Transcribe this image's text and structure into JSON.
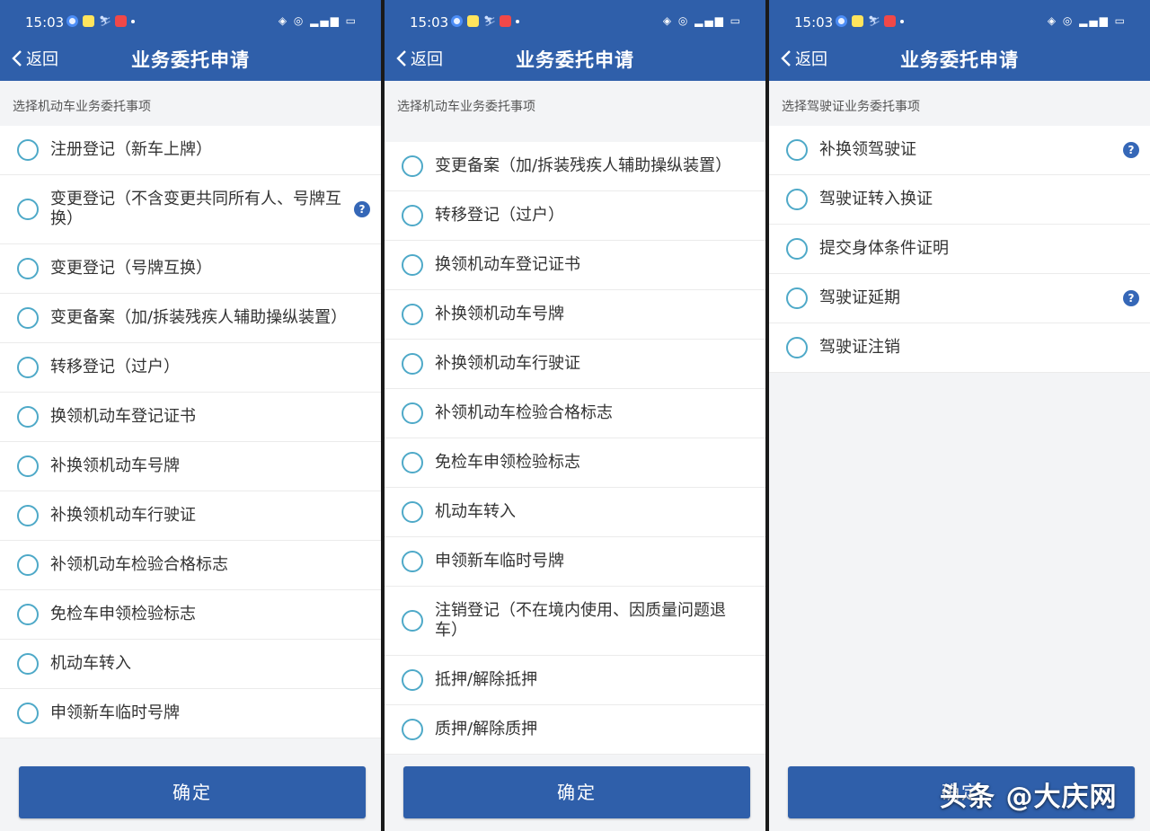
{
  "panels": [
    {
      "status_time": "15:03",
      "back_label": "返回",
      "title": "业务委托申请",
      "section_label": "选择机动车业务委托事项",
      "items": [
        {
          "label": "注册登记（新车上牌）",
          "help": false,
          "lines": 1
        },
        {
          "label": "变更登记（不含变更共同所有人、号牌互换）",
          "help": true,
          "lines": 2
        },
        {
          "label": "变更登记（号牌互换）",
          "help": false,
          "lines": 1
        },
        {
          "label": "变更备案（加/拆装残疾人辅助操纵装置）",
          "help": false,
          "lines": 1
        },
        {
          "label": "转移登记（过户）",
          "help": false,
          "lines": 1
        },
        {
          "label": "换领机动车登记证书",
          "help": false,
          "lines": 1
        },
        {
          "label": "补换领机动车号牌",
          "help": false,
          "lines": 1
        },
        {
          "label": "补换领机动车行驶证",
          "help": false,
          "lines": 1
        },
        {
          "label": "补领机动车检验合格标志",
          "help": false,
          "lines": 1
        },
        {
          "label": "免检车申领检验标志",
          "help": false,
          "lines": 1
        },
        {
          "label": "机动车转入",
          "help": false,
          "lines": 1
        },
        {
          "label": "申领新车临时号牌",
          "help": false,
          "lines": 1
        }
      ],
      "confirm_label": "确定"
    },
    {
      "status_time": "15:03",
      "back_label": "返回",
      "title": "业务委托申请",
      "section_label": "选择机动车业务委托事项",
      "items": [
        {
          "label": "变更备案（加/拆装残疾人辅助操纵装置）",
          "help": false,
          "lines": 1
        },
        {
          "label": "转移登记（过户）",
          "help": false,
          "lines": 1
        },
        {
          "label": "换领机动车登记证书",
          "help": false,
          "lines": 1
        },
        {
          "label": "补换领机动车号牌",
          "help": false,
          "lines": 1
        },
        {
          "label": "补换领机动车行驶证",
          "help": false,
          "lines": 1
        },
        {
          "label": "补领机动车检验合格标志",
          "help": false,
          "lines": 1
        },
        {
          "label": "免检车申领检验标志",
          "help": false,
          "lines": 1
        },
        {
          "label": "机动车转入",
          "help": false,
          "lines": 1
        },
        {
          "label": "申领新车临时号牌",
          "help": false,
          "lines": 1
        },
        {
          "label": "注销登记（不在境内使用、因质量问题退车）",
          "help": false,
          "lines": 2
        },
        {
          "label": "抵押/解除抵押",
          "help": false,
          "lines": 1
        },
        {
          "label": "质押/解除质押",
          "help": false,
          "lines": 1
        }
      ],
      "confirm_label": "确定"
    },
    {
      "status_time": "15:03",
      "back_label": "返回",
      "title": "业务委托申请",
      "section_label": "选择驾驶证业务委托事项",
      "items": [
        {
          "label": "补换领驾驶证",
          "help": true,
          "lines": 1
        },
        {
          "label": "驾驶证转入换证",
          "help": false,
          "lines": 1
        },
        {
          "label": "提交身体条件证明",
          "help": false,
          "lines": 1
        },
        {
          "label": "驾驶证延期",
          "help": true,
          "lines": 1
        },
        {
          "label": "驾驶证注销",
          "help": false,
          "lines": 1
        }
      ],
      "confirm_label": "确定"
    }
  ],
  "watermark": "头条 @大庆网",
  "help_icon_glyph": "?",
  "colors": {
    "header_blue": "#2f5faa",
    "radio_border": "#4ea9c8",
    "help_icon": "#3567b7",
    "page_bg": "#f3f4f6"
  }
}
